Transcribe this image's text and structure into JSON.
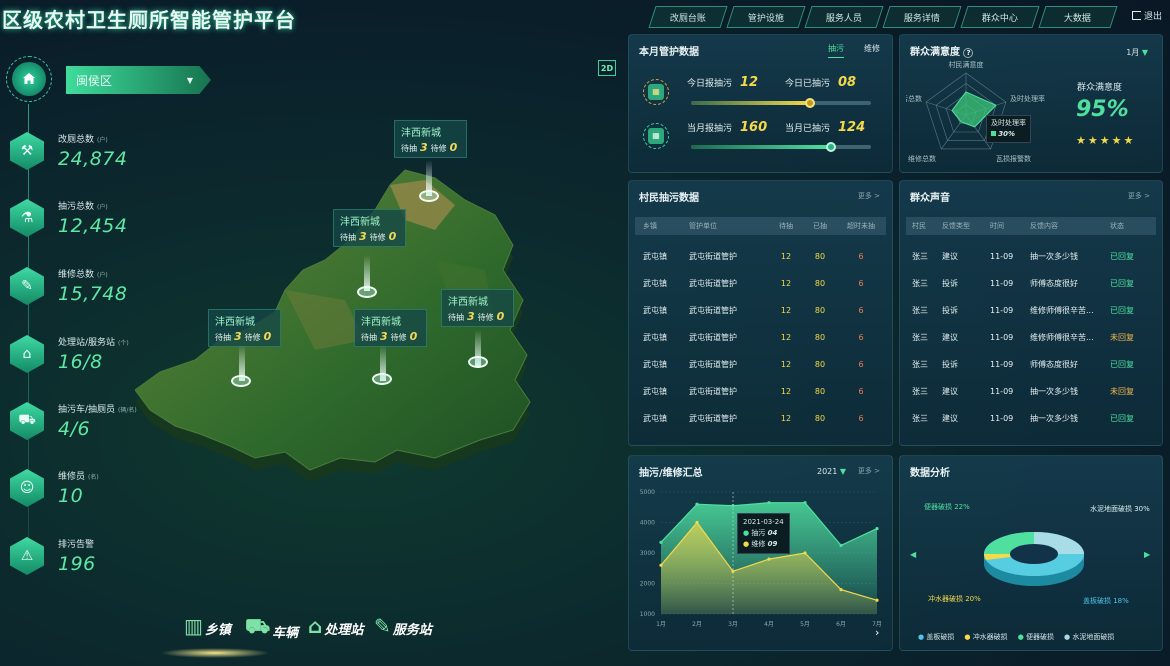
{
  "header": {
    "title": "区级农村卫生厕所智能管护平台",
    "nav": [
      "改厕台账",
      "管护设施",
      "服务人员",
      "服务详情",
      "群众中心",
      "大数据"
    ],
    "logout": "退出"
  },
  "district": {
    "selected": "闽侯区"
  },
  "stats": [
    {
      "label": "改厕总数",
      "unit": "(户)",
      "value": "24,874"
    },
    {
      "label": "抽污总数",
      "unit": "(户)",
      "value": "12,454"
    },
    {
      "label": "维修总数",
      "unit": "(户)",
      "value": "15,748"
    },
    {
      "label": "处理站/服务站",
      "unit": "(个)",
      "value": "16/8"
    },
    {
      "label": "抽污车/抽厕员",
      "unit": "(辆/名)",
      "value": "4/6"
    },
    {
      "label": "维修员",
      "unit": "(名)",
      "value": "10"
    },
    {
      "label": "排污告警",
      "unit": "",
      "value": "196"
    }
  ],
  "map_badge": "2D",
  "map_tips": [
    {
      "name": "沣西新城",
      "a_label": "待抽",
      "a": "3",
      "b_label": "待修",
      "b": "0"
    },
    {
      "name": "沣西新城",
      "a_label": "待抽",
      "a": "3",
      "b_label": "待修",
      "b": "0"
    },
    {
      "name": "沣西新城",
      "a_label": "待抽",
      "a": "3",
      "b_label": "待修",
      "b": "0"
    },
    {
      "name": "沣西新城",
      "a_label": "待抽",
      "a": "3",
      "b_label": "待修",
      "b": "0"
    },
    {
      "name": "沣西新城",
      "a_label": "待抽",
      "a": "3",
      "b_label": "待修",
      "b": "0"
    }
  ],
  "bottom_tabs": [
    "乡镇",
    "车辆",
    "处理站",
    "服务站"
  ],
  "monthly": {
    "title": "本月管护数据",
    "tabs": [
      "抽污",
      "维修"
    ],
    "rows": [
      {
        "k1": "今日报抽污",
        "v1": "12",
        "k2": "今日已抽污",
        "v2": "08",
        "progress": 0.66
      },
      {
        "k1": "当月报抽污",
        "v1": "160",
        "k2": "当月已抽污",
        "v2": "124",
        "progress": 0.78
      }
    ]
  },
  "satisfaction": {
    "title": "群众满意度",
    "month": "1月",
    "axes": [
      "村民满意度",
      "及时处理率",
      "瓦损报警数",
      "维修总数",
      "抽污总数"
    ],
    "values": [
      0.55,
      0.75,
      0.35,
      0.2,
      0.35
    ],
    "tooltip_label": "及时处理率",
    "tooltip_value": "30%",
    "label": "群众满意度",
    "percent": "95%",
    "stars": "★★★★★"
  },
  "villager_table": {
    "title": "村民抽污数据",
    "more": "更多 >",
    "headers": [
      "乡镇",
      "管护单位",
      "待抽",
      "已抽",
      "超时未抽"
    ],
    "rows": [
      [
        "武屯镇",
        "武屯街道管护",
        "12",
        "80",
        "6"
      ],
      [
        "武屯镇",
        "武屯街道管护",
        "12",
        "80",
        "6"
      ],
      [
        "武屯镇",
        "武屯街道管护",
        "12",
        "80",
        "6"
      ],
      [
        "武屯镇",
        "武屯街道管护",
        "12",
        "80",
        "6"
      ],
      [
        "武屯镇",
        "武屯街道管护",
        "12",
        "80",
        "6"
      ],
      [
        "武屯镇",
        "武屯街道管护",
        "12",
        "80",
        "6"
      ],
      [
        "武屯镇",
        "武屯街道管护",
        "12",
        "80",
        "6"
      ]
    ]
  },
  "voice_table": {
    "title": "群众声音",
    "more": "更多 >",
    "headers": [
      "村民",
      "反馈类型",
      "时间",
      "反馈内容",
      "状态"
    ],
    "rows": [
      [
        "张三",
        "建议",
        "11-09",
        "抽一次多少钱",
        "已回复"
      ],
      [
        "张三",
        "投诉",
        "11-09",
        "师傅态度很好",
        "已回复"
      ],
      [
        "张三",
        "投诉",
        "11-09",
        "维修师傅很辛苦...",
        "已回复"
      ],
      [
        "张三",
        "建议",
        "11-09",
        "维修师傅很辛苦...",
        "未回复"
      ],
      [
        "张三",
        "投诉",
        "11-09",
        "师傅态度很好",
        "已回复"
      ],
      [
        "张三",
        "建议",
        "11-09",
        "抽一次多少钱",
        "未回复"
      ],
      [
        "张三",
        "建议",
        "11-09",
        "抽一次多少钱",
        "已回复"
      ]
    ]
  },
  "summary_chart": {
    "title": "抽污/维修汇总",
    "year": "2021",
    "more": "更多 >",
    "tooltip_date": "2021-03-24",
    "tooltip_items": [
      {
        "label": "抽污",
        "value": "04"
      },
      {
        "label": "维修",
        "value": "09"
      }
    ]
  },
  "analysis": {
    "title": "数据分析",
    "labels": [
      {
        "text": "便器破损 22%"
      },
      {
        "text": "水泥地面破损 30%"
      },
      {
        "text": "冲水器破损 20%"
      },
      {
        "text": "盖板破损 18%"
      }
    ],
    "legend": [
      "盖板破损",
      "冲水器破损",
      "便器破损",
      "水泥地面破损"
    ],
    "legend_colors": [
      "#4fc3e8",
      "#f4d94a",
      "#4fe0a0",
      "#a8d8e8"
    ]
  },
  "chart_data": {
    "type": "area",
    "x": [
      "1月",
      "2月",
      "3月",
      "4月",
      "5月",
      "6月",
      "7月"
    ],
    "ylim": [
      1000,
      5000
    ],
    "yticks": [
      1000,
      2000,
      3000,
      4000,
      5000
    ],
    "series": [
      {
        "name": "抽污",
        "values": [
          3350,
          4600,
          4550,
          4650,
          4650,
          3250,
          3800
        ],
        "color": "#4fe0a0"
      },
      {
        "name": "维修",
        "values": [
          2600,
          4000,
          2400,
          2800,
          3000,
          1800,
          1450
        ],
        "color": "#f4d94a"
      }
    ]
  }
}
